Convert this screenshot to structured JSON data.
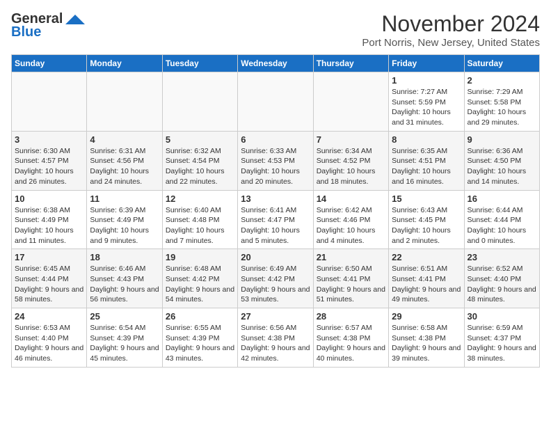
{
  "logo": {
    "line1": "General",
    "line2": "Blue"
  },
  "title": "November 2024",
  "location": "Port Norris, New Jersey, United States",
  "weekdays": [
    "Sunday",
    "Monday",
    "Tuesday",
    "Wednesday",
    "Thursday",
    "Friday",
    "Saturday"
  ],
  "weeks": [
    [
      {
        "day": "",
        "info": ""
      },
      {
        "day": "",
        "info": ""
      },
      {
        "day": "",
        "info": ""
      },
      {
        "day": "",
        "info": ""
      },
      {
        "day": "",
        "info": ""
      },
      {
        "day": "1",
        "info": "Sunrise: 7:27 AM\nSunset: 5:59 PM\nDaylight: 10 hours and 31 minutes."
      },
      {
        "day": "2",
        "info": "Sunrise: 7:29 AM\nSunset: 5:58 PM\nDaylight: 10 hours and 29 minutes."
      }
    ],
    [
      {
        "day": "3",
        "info": "Sunrise: 6:30 AM\nSunset: 4:57 PM\nDaylight: 10 hours and 26 minutes."
      },
      {
        "day": "4",
        "info": "Sunrise: 6:31 AM\nSunset: 4:56 PM\nDaylight: 10 hours and 24 minutes."
      },
      {
        "day": "5",
        "info": "Sunrise: 6:32 AM\nSunset: 4:54 PM\nDaylight: 10 hours and 22 minutes."
      },
      {
        "day": "6",
        "info": "Sunrise: 6:33 AM\nSunset: 4:53 PM\nDaylight: 10 hours and 20 minutes."
      },
      {
        "day": "7",
        "info": "Sunrise: 6:34 AM\nSunset: 4:52 PM\nDaylight: 10 hours and 18 minutes."
      },
      {
        "day": "8",
        "info": "Sunrise: 6:35 AM\nSunset: 4:51 PM\nDaylight: 10 hours and 16 minutes."
      },
      {
        "day": "9",
        "info": "Sunrise: 6:36 AM\nSunset: 4:50 PM\nDaylight: 10 hours and 14 minutes."
      }
    ],
    [
      {
        "day": "10",
        "info": "Sunrise: 6:38 AM\nSunset: 4:49 PM\nDaylight: 10 hours and 11 minutes."
      },
      {
        "day": "11",
        "info": "Sunrise: 6:39 AM\nSunset: 4:49 PM\nDaylight: 10 hours and 9 minutes."
      },
      {
        "day": "12",
        "info": "Sunrise: 6:40 AM\nSunset: 4:48 PM\nDaylight: 10 hours and 7 minutes."
      },
      {
        "day": "13",
        "info": "Sunrise: 6:41 AM\nSunset: 4:47 PM\nDaylight: 10 hours and 5 minutes."
      },
      {
        "day": "14",
        "info": "Sunrise: 6:42 AM\nSunset: 4:46 PM\nDaylight: 10 hours and 4 minutes."
      },
      {
        "day": "15",
        "info": "Sunrise: 6:43 AM\nSunset: 4:45 PM\nDaylight: 10 hours and 2 minutes."
      },
      {
        "day": "16",
        "info": "Sunrise: 6:44 AM\nSunset: 4:44 PM\nDaylight: 10 hours and 0 minutes."
      }
    ],
    [
      {
        "day": "17",
        "info": "Sunrise: 6:45 AM\nSunset: 4:44 PM\nDaylight: 9 hours and 58 minutes."
      },
      {
        "day": "18",
        "info": "Sunrise: 6:46 AM\nSunset: 4:43 PM\nDaylight: 9 hours and 56 minutes."
      },
      {
        "day": "19",
        "info": "Sunrise: 6:48 AM\nSunset: 4:42 PM\nDaylight: 9 hours and 54 minutes."
      },
      {
        "day": "20",
        "info": "Sunrise: 6:49 AM\nSunset: 4:42 PM\nDaylight: 9 hours and 53 minutes."
      },
      {
        "day": "21",
        "info": "Sunrise: 6:50 AM\nSunset: 4:41 PM\nDaylight: 9 hours and 51 minutes."
      },
      {
        "day": "22",
        "info": "Sunrise: 6:51 AM\nSunset: 4:41 PM\nDaylight: 9 hours and 49 minutes."
      },
      {
        "day": "23",
        "info": "Sunrise: 6:52 AM\nSunset: 4:40 PM\nDaylight: 9 hours and 48 minutes."
      }
    ],
    [
      {
        "day": "24",
        "info": "Sunrise: 6:53 AM\nSunset: 4:40 PM\nDaylight: 9 hours and 46 minutes."
      },
      {
        "day": "25",
        "info": "Sunrise: 6:54 AM\nSunset: 4:39 PM\nDaylight: 9 hours and 45 minutes."
      },
      {
        "day": "26",
        "info": "Sunrise: 6:55 AM\nSunset: 4:39 PM\nDaylight: 9 hours and 43 minutes."
      },
      {
        "day": "27",
        "info": "Sunrise: 6:56 AM\nSunset: 4:38 PM\nDaylight: 9 hours and 42 minutes."
      },
      {
        "day": "28",
        "info": "Sunrise: 6:57 AM\nSunset: 4:38 PM\nDaylight: 9 hours and 40 minutes."
      },
      {
        "day": "29",
        "info": "Sunrise: 6:58 AM\nSunset: 4:38 PM\nDaylight: 9 hours and 39 minutes."
      },
      {
        "day": "30",
        "info": "Sunrise: 6:59 AM\nSunset: 4:37 PM\nDaylight: 9 hours and 38 minutes."
      }
    ]
  ]
}
